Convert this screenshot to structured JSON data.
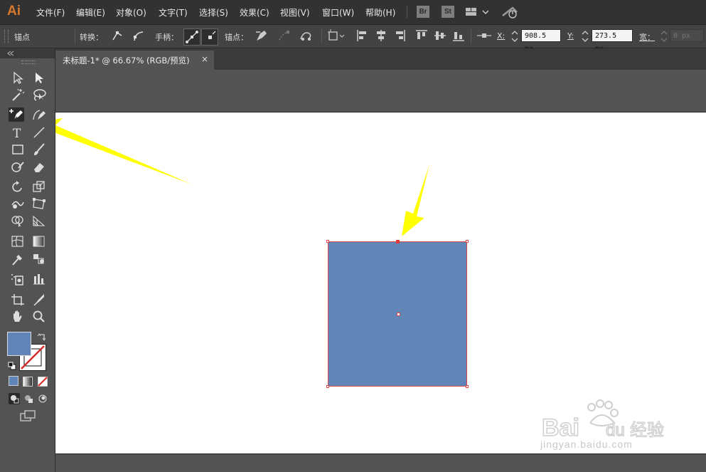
{
  "app": {
    "logo": "Ai"
  },
  "menu": [
    "文件(F)",
    "编辑(E)",
    "对象(O)",
    "文字(T)",
    "选择(S)",
    "效果(C)",
    "视图(V)",
    "窗口(W)",
    "帮助(H)"
  ],
  "menubar_buttons": {
    "bridge": "Br",
    "stock": "St"
  },
  "control_bar": {
    "selection_label": "锚点",
    "convert_label": "转换：",
    "handles_label": "手柄：",
    "anchors_label": "锚点：",
    "x_label": "X:",
    "x_value": "908.5 px",
    "y_label": "Y:",
    "y_value": "273.5 px",
    "width_label": "宽：",
    "width_value": "0 px"
  },
  "document_tab": {
    "title": "未标题-1* @ 66.67% (RGB/预览)",
    "close": "×"
  },
  "colors": {
    "fill": "#6185b7",
    "selection": "#d94a4a",
    "annotation_arrow": "#ffff00",
    "app_logo": "#d8792c"
  },
  "tools": [
    "direct-selection-icon",
    "group-selection-icon",
    "magic-wand-icon",
    "lasso-icon",
    "add-anchor-point-icon",
    "curvature-pen-icon",
    "type-icon",
    "line-segment-icon",
    "rectangle-icon",
    "paintbrush-icon",
    "shaper-icon",
    "eraser-icon",
    "rotate-icon",
    "scale-icon",
    "warp-icon",
    "free-transform-icon",
    "shape-builder-icon",
    "perspective-grid-icon",
    "mesh-icon",
    "gradient-icon",
    "eyedropper-icon",
    "blend-icon",
    "symbol-sprayer-icon",
    "column-graph-icon",
    "artboard-icon",
    "slice-icon",
    "hand-icon",
    "zoom-icon"
  ],
  "watermark": {
    "logo": "Baidu经验",
    "url": "jingyan.baidu.com"
  }
}
